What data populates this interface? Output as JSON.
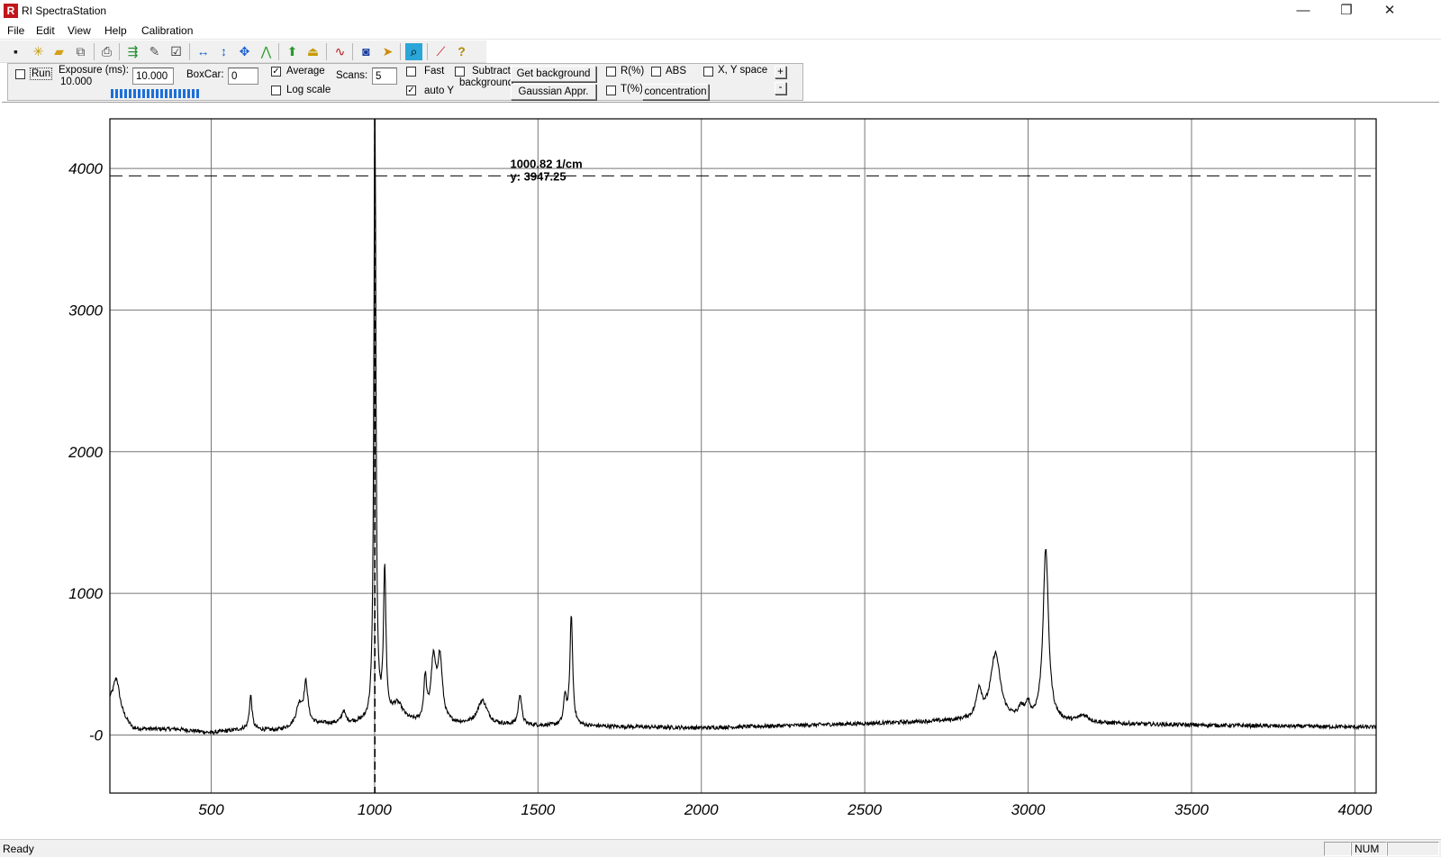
{
  "window": {
    "title": "RI SpectraStation",
    "icon_letter": "R",
    "minimize_glyph": "—",
    "restore_glyph": "❐",
    "close_glyph": "✕"
  },
  "menu": [
    "File",
    "Edit",
    "View",
    "Help",
    "Calibration"
  ],
  "toolbar_icons": [
    "save-icon",
    "new-file-icon",
    "open-folder-icon",
    "copy-icon",
    "print-icon",
    "export-icon",
    "settings-icon",
    "checklist-icon",
    "zoom-horizontal-icon",
    "zoom-vertical-icon",
    "zoom-both-icon",
    "peak-icon",
    "up-arrow-icon",
    "folder-up-icon",
    "spectrum-icon",
    "camera-icon",
    "highlight-icon",
    "search-icon",
    "line-tool-icon",
    "help-icon"
  ],
  "controls": {
    "run_label": "Run",
    "run_checked": false,
    "exposure_label": "Exposure (ms):",
    "exposure_value": "10.000",
    "exposure_input": "10.000",
    "boxcar_label": "BoxCar:",
    "boxcar_input": "0",
    "average_label": "Average",
    "average_checked": true,
    "log_scale_label": "Log scale",
    "log_scale_checked": false,
    "scans_label": "Scans:",
    "scans_input": "5",
    "fast_label": "Fast",
    "fast_checked": false,
    "auto_y_label": "auto Y",
    "auto_y_checked": true,
    "subtract_label_1": "Subtract",
    "subtract_label_2": "background",
    "subtract_checked": false,
    "get_background_button": "Get background",
    "gaussian_button": "Gaussian Appr.",
    "r_label": "R(%)",
    "r_checked": false,
    "t_label": "T(%)",
    "t_checked": false,
    "abs_label": "ABS",
    "abs_checked": false,
    "xy_space_label": "X, Y space",
    "xy_space_checked": false,
    "concentration_button": "concentration",
    "plus_button": "+",
    "minus_button": "-"
  },
  "cursor": {
    "x_label": "1000.82 1/cm",
    "y_label": "y: 3947.25",
    "x_value": 1000.82,
    "y_value": 3947.25
  },
  "chart_data": {
    "type": "line",
    "title": "",
    "xlabel": "",
    "ylabel": "",
    "xlim": [
      190,
      4065
    ],
    "ylim": [
      -410,
      4350
    ],
    "x_ticks": [
      500,
      1000,
      1500,
      2000,
      2500,
      3000,
      3500,
      4000
    ],
    "x_tick_labels": [
      "500",
      "1000",
      "1500",
      "2000",
      "2500",
      "3000",
      "3500",
      "4000"
    ],
    "y_ticks": [
      0,
      1000,
      2000,
      3000,
      4000
    ],
    "y_tick_labels": [
      "-0",
      "1000",
      "2000",
      "3000",
      "4000"
    ],
    "grid": true,
    "series": [
      {
        "baseline_points": [
          [
            190,
            220
          ],
          [
            260,
            40
          ],
          [
            400,
            40
          ],
          [
            500,
            15
          ],
          [
            600,
            40
          ],
          [
            700,
            30
          ],
          [
            800,
            70
          ],
          [
            900,
            80
          ],
          [
            1700,
            60
          ],
          [
            2000,
            50
          ],
          [
            2500,
            80
          ],
          [
            2800,
            100
          ],
          [
            3200,
            80
          ],
          [
            3500,
            70
          ],
          [
            4065,
            55
          ]
        ],
        "peaks": [
          {
            "x": 210,
            "height": 230,
            "width": 12
          },
          {
            "x": 621,
            "height": 240,
            "width": 5
          },
          {
            "x": 770,
            "height": 150,
            "width": 12
          },
          {
            "x": 790,
            "height": 280,
            "width": 7
          },
          {
            "x": 905,
            "height": 80,
            "width": 7
          },
          {
            "x": 1001,
            "height": 4700,
            "width": 3.5
          },
          {
            "x": 1031,
            "height": 1050,
            "width": 4.5
          },
          {
            "x": 1070,
            "height": 130,
            "width": 22
          },
          {
            "x": 1155,
            "height": 300,
            "width": 5
          },
          {
            "x": 1180,
            "height": 420,
            "width": 9
          },
          {
            "x": 1200,
            "height": 440,
            "width": 9
          },
          {
            "x": 1330,
            "height": 170,
            "width": 18
          },
          {
            "x": 1445,
            "height": 220,
            "width": 6
          },
          {
            "x": 1583,
            "height": 200,
            "width": 5
          },
          {
            "x": 1602,
            "height": 780,
            "width": 5
          },
          {
            "x": 2850,
            "height": 200,
            "width": 10
          },
          {
            "x": 2900,
            "height": 470,
            "width": 18
          },
          {
            "x": 2980,
            "height": 80,
            "width": 12
          },
          {
            "x": 3000,
            "height": 100,
            "width": 6
          },
          {
            "x": 3054,
            "height": 1220,
            "width": 10
          },
          {
            "x": 3170,
            "height": 50,
            "width": 20
          }
        ],
        "noise": 14,
        "color": "#000000"
      }
    ]
  },
  "status": {
    "text": "Ready",
    "num": "NUM"
  }
}
